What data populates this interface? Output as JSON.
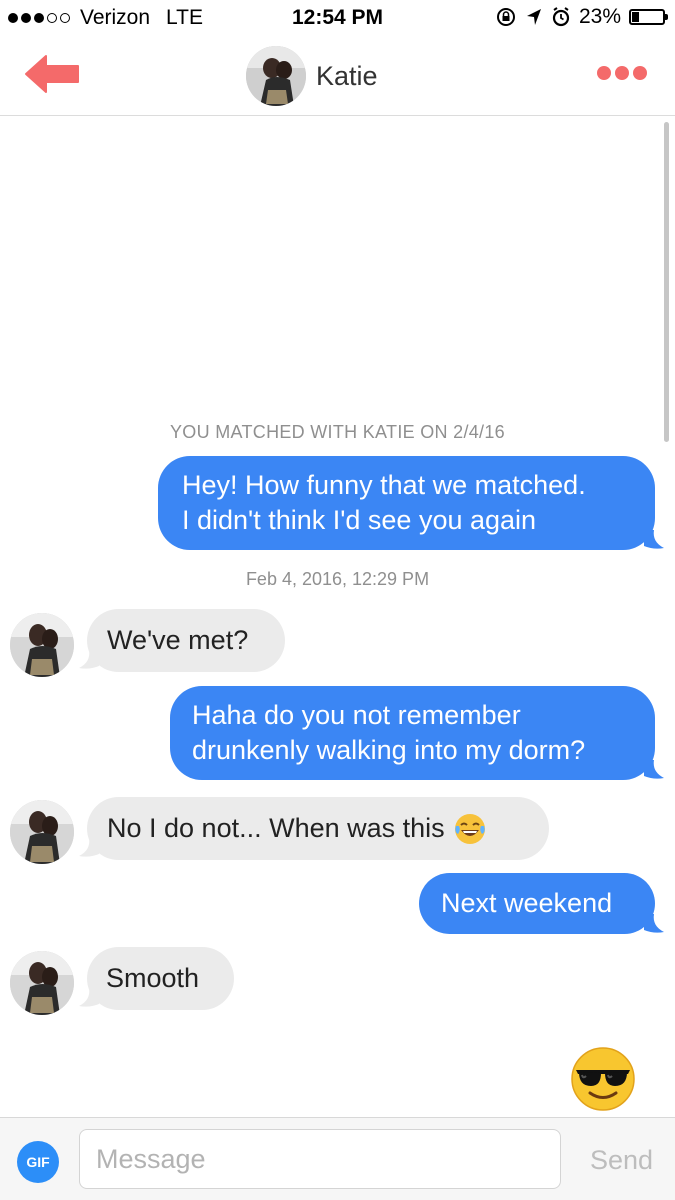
{
  "status_bar": {
    "carrier": "Verizon",
    "network": "LTE",
    "time": "12:54 PM",
    "battery_percent": "23%",
    "battery_level": 0.23,
    "signal_bars_filled": 3,
    "signal_bars_total": 5
  },
  "nav": {
    "contact_name": "Katie",
    "back_icon": "back-arrow-icon",
    "more_icon": "more-dots-icon",
    "accent_color": "#f46a6a"
  },
  "chat": {
    "matched_banner": "YOU MATCHED WITH KATIE ON 2/4/16",
    "timestamp": "Feb 4, 2016, 12:29 PM",
    "messages": [
      {
        "direction": "out",
        "lines": [
          "Hey! How funny that we matched.",
          "I didn't think I'd see you again"
        ]
      },
      {
        "direction": "in",
        "lines": [
          "We've met?"
        ]
      },
      {
        "direction": "out",
        "lines": [
          "Haha do you not remember",
          "drunkenly walking into my dorm?"
        ]
      },
      {
        "direction": "in",
        "lines": [
          "No I do not... When was this"
        ],
        "emoji": "tears-of-joy-emoji"
      },
      {
        "direction": "out",
        "lines": [
          "Next weekend"
        ]
      },
      {
        "direction": "in",
        "lines": [
          "Smooth"
        ]
      }
    ],
    "reaction_emoji": "sunglasses-emoji",
    "outgoing_color": "#3b86f4",
    "incoming_color": "#ebebeb"
  },
  "composer": {
    "gif_label": "GIF",
    "placeholder": "Message",
    "send_label": "Send"
  }
}
